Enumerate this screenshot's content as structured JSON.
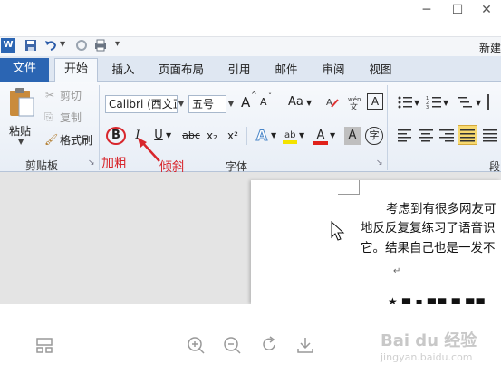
{
  "window": {
    "title_right": "新建"
  },
  "ribbon": {
    "tabs": [
      "文件",
      "开始",
      "插入",
      "页面布局",
      "引用",
      "邮件",
      "审阅",
      "视图"
    ],
    "clipboard": {
      "paste": "粘贴",
      "cut": "剪切",
      "copy": "复制",
      "format_painter": "格式刷",
      "group_label": "剪贴板"
    },
    "font": {
      "font_name": "Calibri (西文正文)",
      "font_size": "五号",
      "bold": "B",
      "italic": "I",
      "underline": "U",
      "strike": "abc",
      "subscript": "x₂",
      "superscript": "x²",
      "grow": "A",
      "shrink": "A",
      "case": "Aa",
      "clear": "A",
      "color_a": "A",
      "shade_a": "A",
      "circle_char": "字",
      "group_label": "字体"
    },
    "paragraph": {
      "group_label_partial": "段"
    }
  },
  "annotations": {
    "bold_label": "加粗",
    "italic_label": "倾斜"
  },
  "document": {
    "lines": [
      "考虑到有很多网友可",
      "地反反复复练习了语音识",
      "它。结果自己也是一发不"
    ],
    "para_mark": "↵",
    "bottom_fragment": "★ ■ ▪ ■■ ■ ■■"
  },
  "watermark": {
    "main": "Bai du 经验",
    "sub": "jingyan.baidu.com"
  },
  "colors": {
    "file_tab": "#2b65b3",
    "ribbon_bg": "#e8eef6",
    "annotation_red": "#d8262c",
    "highlight_yellow": "#f4e300",
    "font_red": "#e0211a",
    "active_align": "#f7d96f"
  }
}
